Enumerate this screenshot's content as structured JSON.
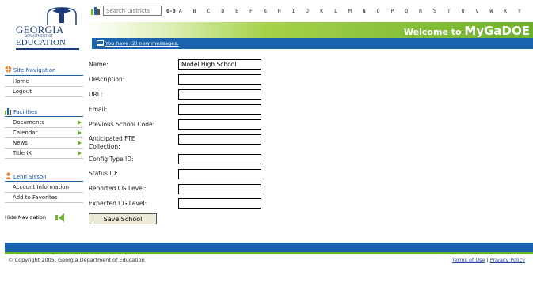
{
  "header": {
    "logo": {
      "line1": "GEORGIA",
      "line2": "DEPARTMENT OF",
      "line3": "EDUCATION"
    },
    "search_placeholder": "Search Districts",
    "alpha_index": [
      "0-9",
      "A",
      "B",
      "C",
      "D",
      "E",
      "F",
      "G",
      "H",
      "I",
      "J",
      "K",
      "L",
      "M",
      "N",
      "O",
      "P",
      "Q",
      "R",
      "S",
      "T",
      "U",
      "V",
      "W",
      "X",
      "Y"
    ],
    "welcome_prefix": "Welcome to",
    "welcome_brand": "MyGaDOE",
    "message_link": "You have (2) new messages."
  },
  "sidebar": {
    "site_nav": {
      "title": "Site Navigation",
      "items": [
        {
          "label": "Home"
        },
        {
          "label": "Logout"
        }
      ]
    },
    "facilities": {
      "title": "Facilities",
      "items": [
        {
          "label": "Documents"
        },
        {
          "label": "Calendar"
        },
        {
          "label": "News"
        },
        {
          "label": "Title IX"
        }
      ]
    },
    "user": {
      "title": "Lenn Sisson",
      "items": [
        {
          "label": "Account Information"
        },
        {
          "label": "Add to Favorites"
        }
      ]
    },
    "hide_nav": "Hide Navigation"
  },
  "form": {
    "fields": [
      {
        "label": "Name:",
        "value": "Model High School"
      },
      {
        "label": "Description:",
        "value": ""
      },
      {
        "label": "URL:",
        "value": ""
      },
      {
        "label": "Email:",
        "value": ""
      },
      {
        "label": "Previous School Code:",
        "value": ""
      },
      {
        "label_line1": "Anticipated FTE",
        "label_line2": "Collection:",
        "value": ""
      },
      {
        "label": "Config Type ID:",
        "value": ""
      },
      {
        "label": "Status ID:",
        "value": ""
      },
      {
        "label": "Reported CG Level:",
        "value": ""
      },
      {
        "label": "Expected CG Level:",
        "value": ""
      }
    ],
    "save_label": "Save School"
  },
  "footer": {
    "copyright": "© Copyright 2005, Georgia Department of Education",
    "terms": "Terms of Use",
    "separator": "|",
    "privacy": "Privacy Policy"
  },
  "colors": {
    "blue": "#1b63ad",
    "green": "#6db12b",
    "navy": "#1a3c7a"
  }
}
